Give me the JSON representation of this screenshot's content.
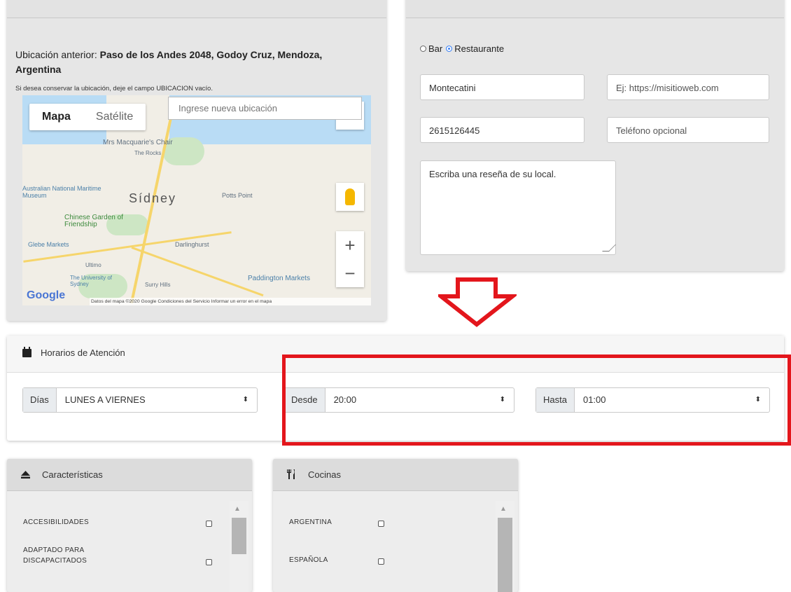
{
  "location": {
    "previous_label": "Ubicación anterior: ",
    "previous_address": "Paso de los Andes 2048, Godoy Cruz, Mendoza, Argentina",
    "hint": "Si desea conservar la ubicación, deje el campo UBICACION vacío.",
    "map": {
      "tab_map": "Mapa",
      "tab_satellite": "Satélite",
      "search_placeholder": "Ingrese nueva ubicación",
      "labels": [
        "Mrs Macquarie's Chair",
        "The Rocks",
        "Australian National Maritime Museum",
        "Sídney",
        "Potts Point",
        "Chinese Garden of Friendship",
        "Glebe Markets",
        "Darlinghurst",
        "Ultimo",
        "The University of Sydney",
        "Surry Hills",
        "Paddington Markets"
      ],
      "logo": "Google",
      "footer": "Datos del mapa ©2020 Google   Condiciones del Servicio   Informar un error en el mapa"
    }
  },
  "data": {
    "type_bar": "Bar",
    "type_restaurant": "Restaurante",
    "selected_type": "Restaurante",
    "name_value": "Montecatini",
    "website_placeholder": "Ej: https://misitioweb.com",
    "phone_value": "2615126445",
    "phone_optional_placeholder": "Teléfono opcional",
    "review_placeholder": "Escriba una reseña de su local."
  },
  "schedule": {
    "title": "Horarios de Atención",
    "days_label": "Días",
    "days_value": "LUNES A VIERNES",
    "from_label": "Desde",
    "from_value": "20:00",
    "to_label": "Hasta",
    "to_value": "01:00",
    "caret": "⬍"
  },
  "features": {
    "title": "Características",
    "items": [
      {
        "label": "ACCESIBILIDADES"
      },
      {
        "label": "ADAPTADO PARA DISCAPACITADOS"
      }
    ]
  },
  "cuisines": {
    "title": "Cocinas",
    "items": [
      {
        "label": "ARGENTINA"
      },
      {
        "label": "ESPAÑOLA"
      }
    ]
  },
  "colors": {
    "highlight": "#e3161c",
    "radio_selected": "#3b82f6"
  }
}
